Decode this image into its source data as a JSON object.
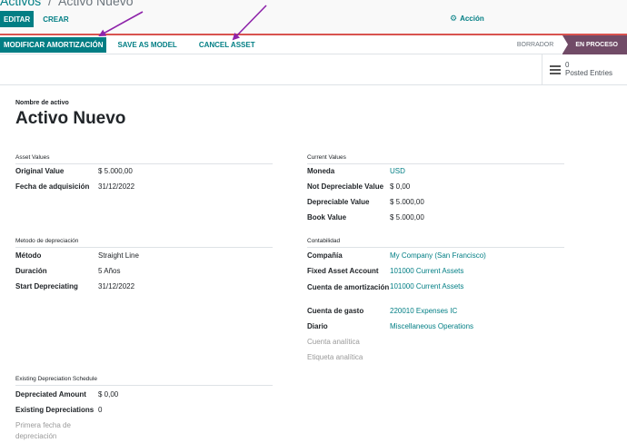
{
  "breadcrumb": {
    "parent": "Activos",
    "separator": "/",
    "current": "Activo Nuevo"
  },
  "toolbar": {
    "edit_label": "EDITAR",
    "create_label": "CREAR",
    "action_label": "Acción",
    "action_icon": "gear-icon"
  },
  "statusbar": {
    "buttons": [
      "MODIFICAR AMORTIZACIÓN",
      "SAVE AS MODEL",
      "CANCEL ASSET"
    ],
    "stages": [
      {
        "label": "BORRADOR",
        "active": false
      },
      {
        "label": "EN PROCESO",
        "active": true
      }
    ]
  },
  "smart_button": {
    "count": "0",
    "label": "Posted Entries"
  },
  "record": {
    "name_label": "Nombre de activo",
    "name": "Activo Nuevo"
  },
  "asset_values": {
    "title": "Asset Values",
    "fields": [
      {
        "label": "Original Value",
        "value": "$ 5.000,00"
      },
      {
        "label": "Fecha de adquisición",
        "value": "31/12/2022"
      }
    ]
  },
  "current_values": {
    "title": "Current Values",
    "fields": [
      {
        "label": "Moneda",
        "value": "USD"
      },
      {
        "label": "Not Depreciable Value",
        "value": "$ 0,00"
      },
      {
        "label": "Depreciable Value",
        "value": "$ 5.000,00"
      },
      {
        "label": "Book Value",
        "value": "$ 5.000,00"
      }
    ]
  },
  "depreciation_method": {
    "title": "Metodo de depreciación",
    "fields": [
      {
        "label": "Método",
        "value": "Straight Line"
      },
      {
        "label": "Duración",
        "value": "5 Años"
      },
      {
        "label": "Start Depreciating",
        "value": "31/12/2022"
      }
    ]
  },
  "accounting": {
    "title": "Contabilidad",
    "fields": [
      {
        "label": "Compañía",
        "value": "My Company (San Francisco)"
      },
      {
        "label": "Fixed Asset Account",
        "value": "101000 Current Assets"
      },
      {
        "label": "Cuenta de amortización",
        "value": "101000 Current Assets"
      },
      {
        "label": "Cuenta de gasto",
        "value": "220010 Expenses IC"
      },
      {
        "label": "Diario",
        "value": "Miscellaneous Operations"
      },
      {
        "label": "Cuenta analítica",
        "value": ""
      },
      {
        "label": "Etiqueta analítica",
        "value": ""
      }
    ]
  },
  "existing_schedule": {
    "title": "Existing Depreciation Schedule",
    "fields": [
      {
        "label": "Depreciated Amount",
        "value": "$ 0,00"
      },
      {
        "label": "Existing Depreciations",
        "value": "0"
      },
      {
        "label": "Primera fecha de depreciación",
        "value": ""
      }
    ]
  },
  "colors": {
    "primary": "#017e84",
    "stage_active": "#714b67",
    "annotation_arrow": "#8e24aa",
    "status_border": "#d9534f"
  }
}
